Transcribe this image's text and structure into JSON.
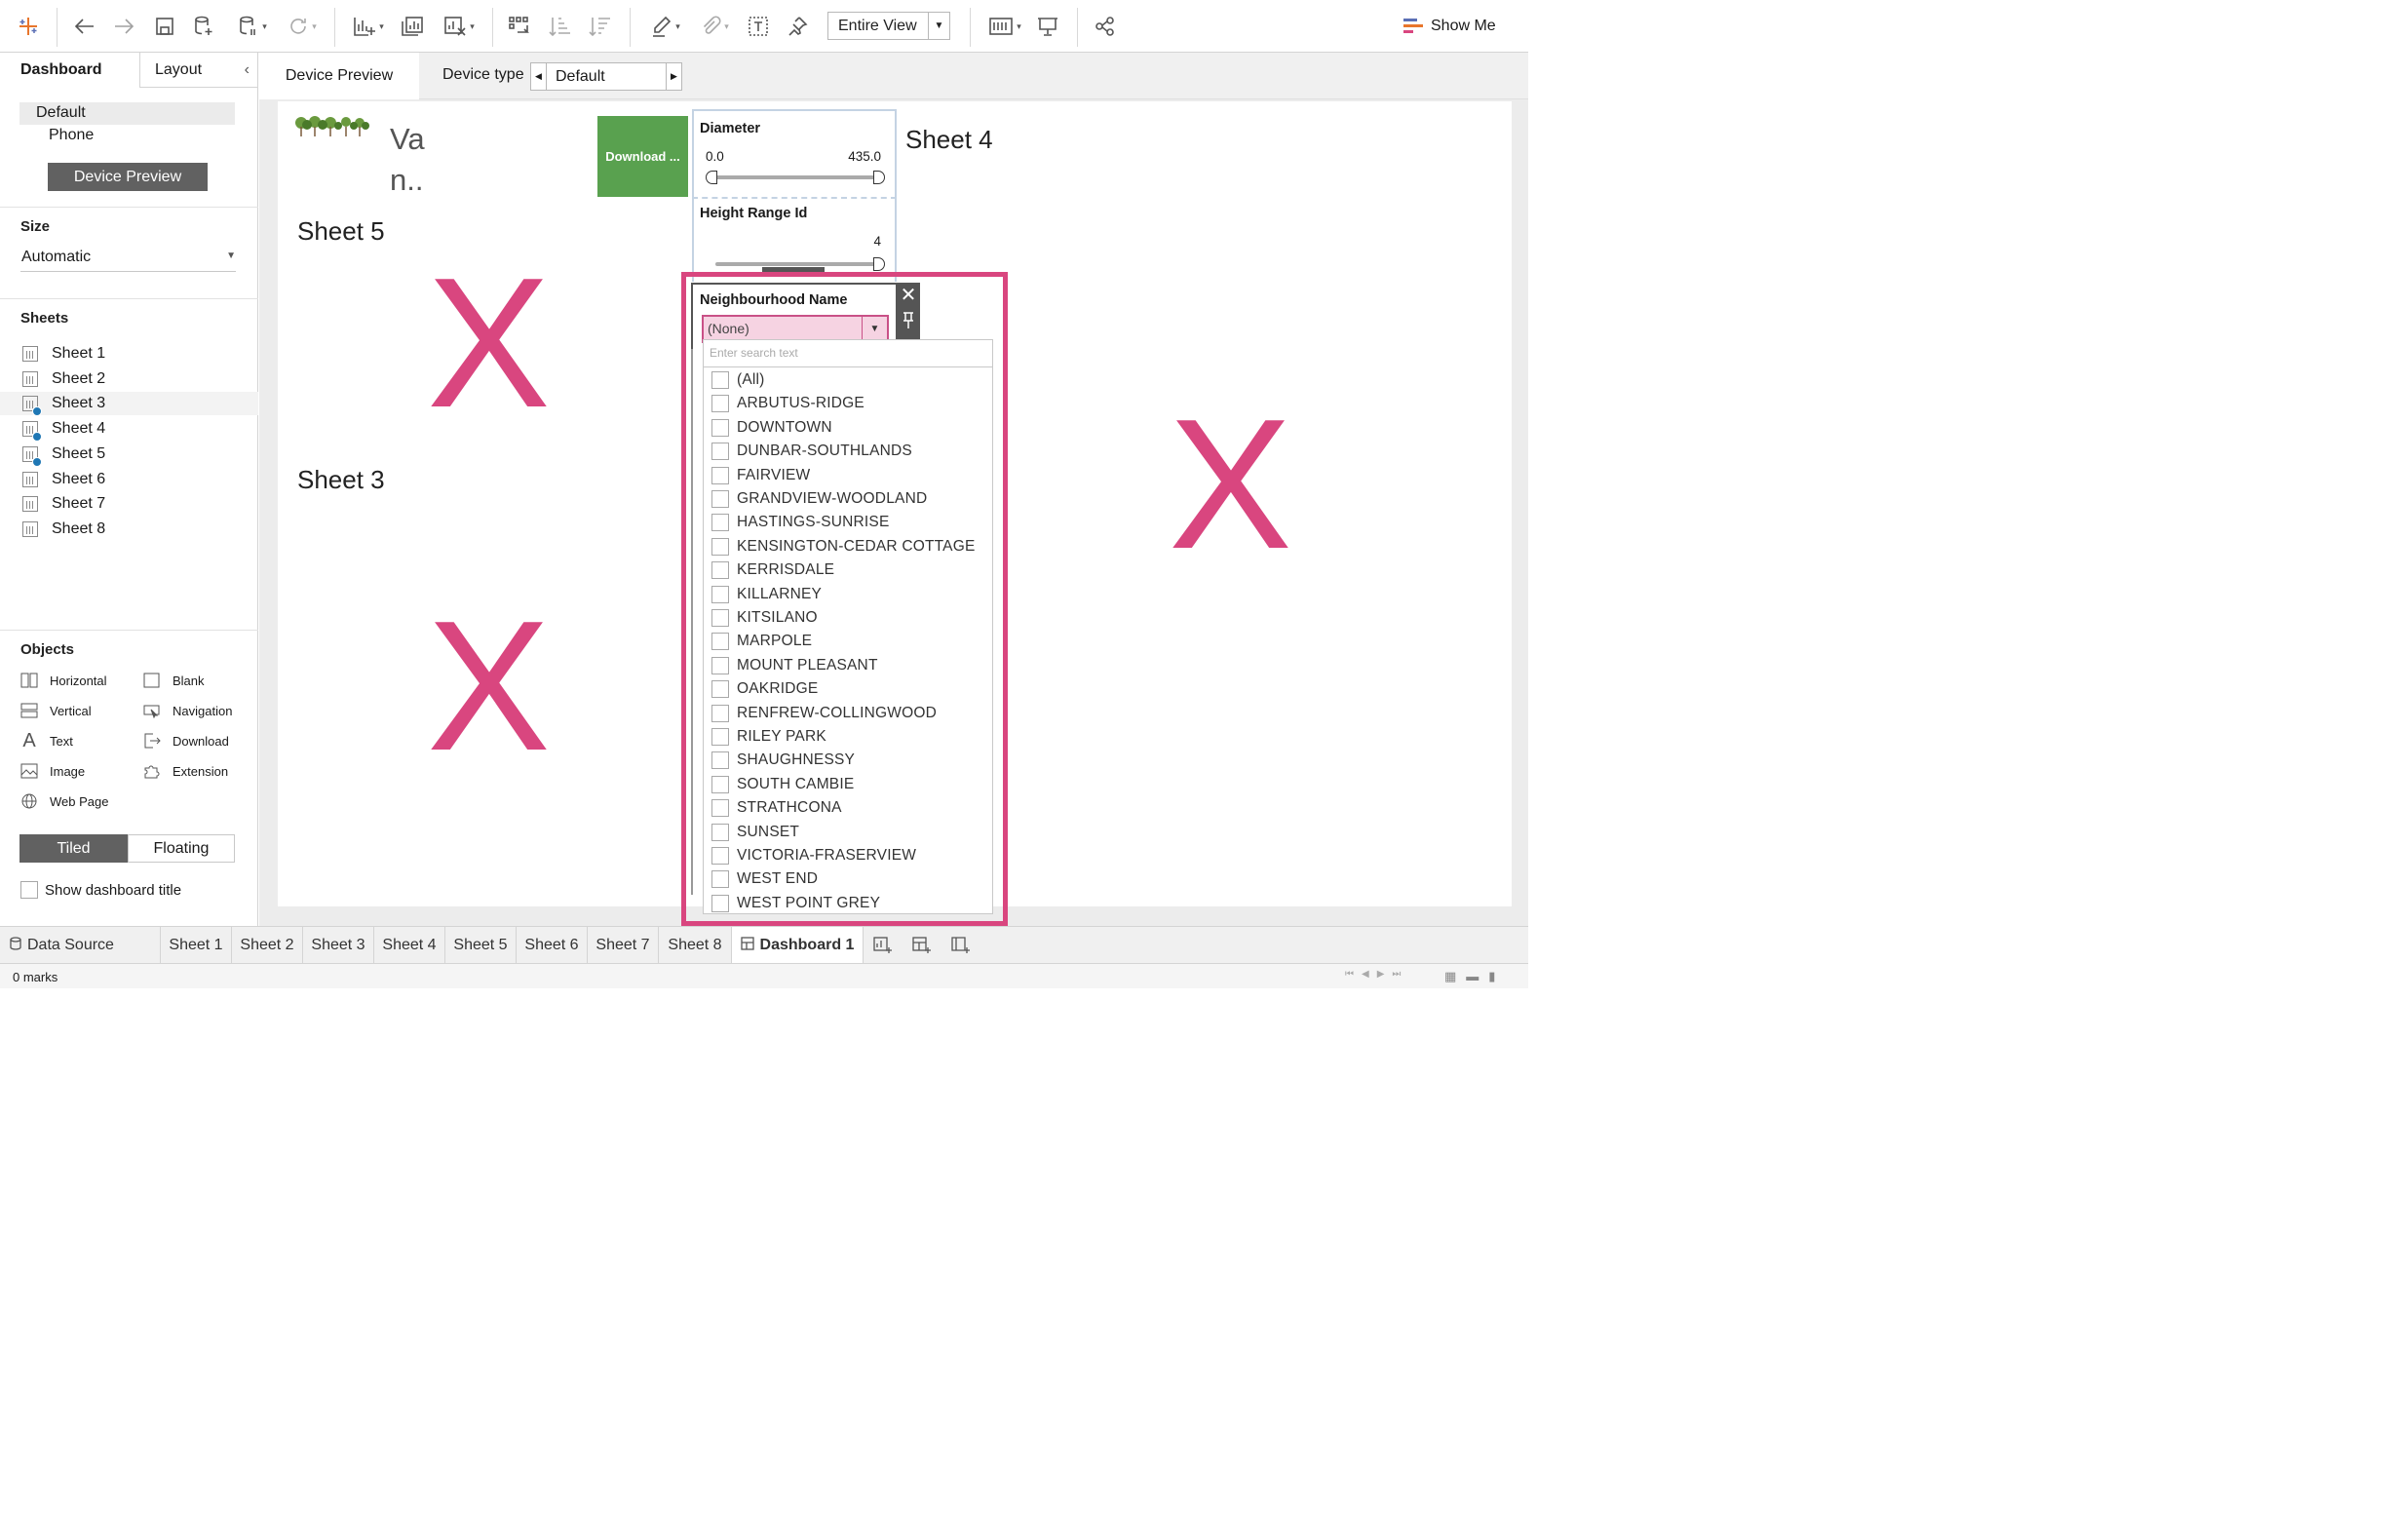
{
  "toolbar": {
    "fit_value": "Entire View",
    "show_me_label": "Show Me"
  },
  "left_panel": {
    "tab_dashboard": "Dashboard",
    "tab_layout": "Layout",
    "device_options": [
      "Default",
      "Phone"
    ],
    "device_preview_button": "Device Preview",
    "size_title": "Size",
    "size_value": "Automatic",
    "sheets_title": "Sheets",
    "sheets": [
      {
        "label": "Sheet 1",
        "used": false
      },
      {
        "label": "Sheet 2",
        "used": false
      },
      {
        "label": "Sheet 3",
        "used": true
      },
      {
        "label": "Sheet 4",
        "used": true
      },
      {
        "label": "Sheet 5",
        "used": true
      },
      {
        "label": "Sheet 6",
        "used": false
      },
      {
        "label": "Sheet 7",
        "used": false
      },
      {
        "label": "Sheet 8",
        "used": false
      }
    ],
    "objects_title": "Objects",
    "objects": [
      "Horizontal",
      "Blank",
      "Vertical",
      "Navigation",
      "Text",
      "Download",
      "Image",
      "Extension",
      "Web Page"
    ],
    "tiled_label": "Tiled",
    "floating_label": "Floating",
    "show_title_label": "Show dashboard title"
  },
  "device_bar": {
    "preview_tab": "Device Preview",
    "device_type_label": "Device type",
    "device_type_value": "Default"
  },
  "dashboard": {
    "title_fragment_1": "Va",
    "title_fragment_2": "n..",
    "download_button": "Download ...",
    "sheet5_title": "Sheet 5",
    "sheet3_title": "Sheet 3",
    "sheet4_title": "Sheet 4",
    "placeholder_mark": "X",
    "diameter": {
      "title": "Diameter",
      "min": "0.0",
      "max": "435.0"
    },
    "height_range": {
      "title": "Height Range Id",
      "max": "4"
    },
    "neighbourhood": {
      "title": "Neighbourhood Name",
      "selected": "(None)",
      "search_placeholder": "Enter search text",
      "items": [
        "(All)",
        "ARBUTUS-RIDGE",
        "DOWNTOWN",
        "DUNBAR-SOUTHLANDS",
        "FAIRVIEW",
        "GRANDVIEW-WOODLAND",
        "HASTINGS-SUNRISE",
        "KENSINGTON-CEDAR COTTAGE",
        "KERRISDALE",
        "KILLARNEY",
        "KITSILANO",
        "MARPOLE",
        "MOUNT PLEASANT",
        "OAKRIDGE",
        "RENFREW-COLLINGWOOD",
        "RILEY PARK",
        "SHAUGHNESSY",
        "SOUTH CAMBIE",
        "STRATHCONA",
        "SUNSET",
        "VICTORIA-FRASERVIEW",
        "WEST END",
        "WEST POINT GREY"
      ]
    }
  },
  "bottom_tabs": [
    "Data Source",
    "Sheet 1",
    "Sheet 2",
    "Sheet 3",
    "Sheet 4",
    "Sheet 5",
    "Sheet 6",
    "Sheet 7",
    "Sheet 8",
    "Dashboard 1"
  ],
  "status": {
    "marks": "0 marks"
  },
  "colors": {
    "accent_pink": "#d9467f",
    "download_green": "#59a14f",
    "check_blue": "#1f77b4"
  }
}
